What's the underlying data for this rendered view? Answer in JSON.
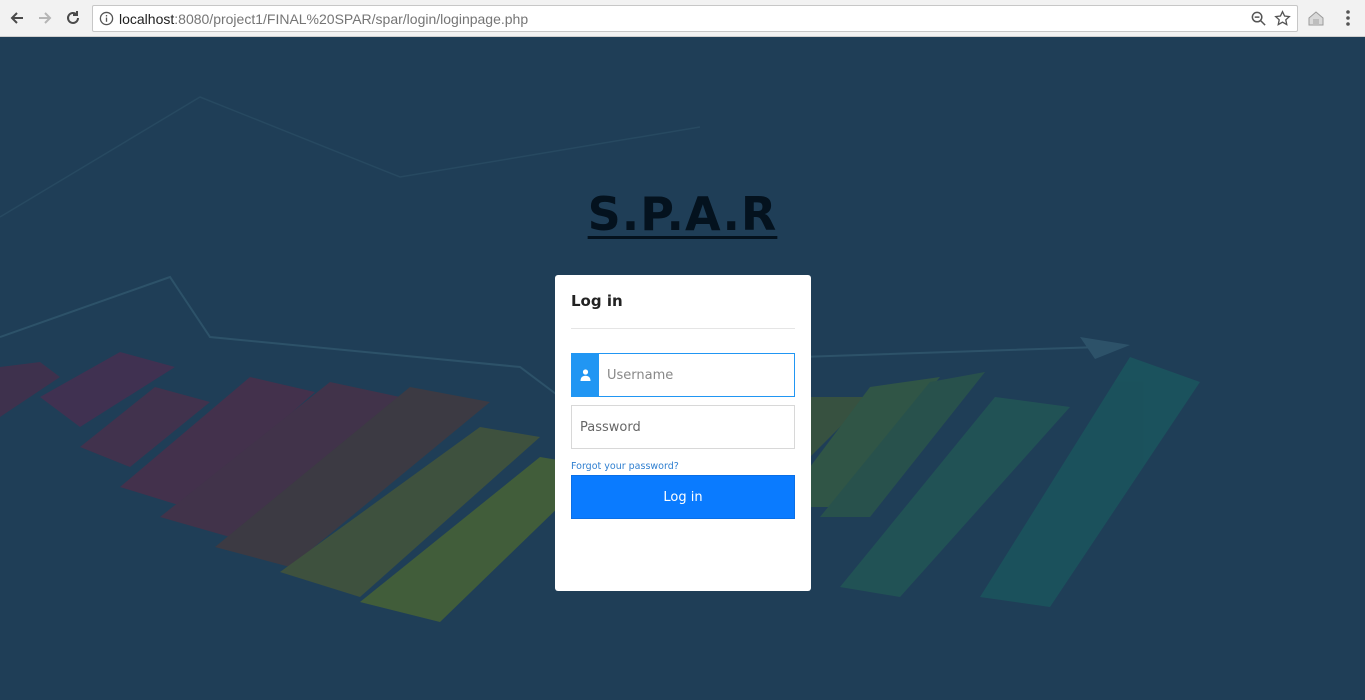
{
  "browser": {
    "url_host": "localhost",
    "url_path": ":8080/project1/FINAL%20SPAR/spar/login/loginpage.php"
  },
  "page": {
    "brand_title": "S.P.A.R"
  },
  "login": {
    "title": "Log in",
    "username_placeholder": "Username",
    "password_placeholder": "Password",
    "forgot_label": "Forgot your password?",
    "submit_label": "Log in"
  },
  "colors": {
    "accent": "#0a7bff",
    "icon_addon": "#2196f3",
    "page_overlay": "#1f3f57"
  }
}
